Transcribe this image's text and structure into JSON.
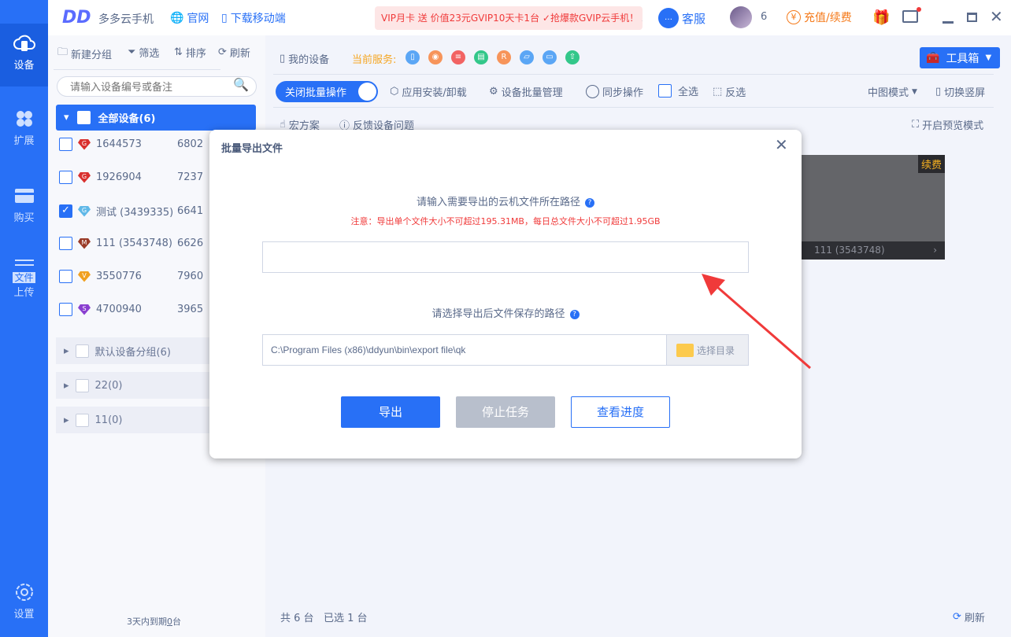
{
  "app": {
    "name": "多多云手机",
    "website": "官网",
    "download": "下载移动端",
    "promo": "VIP月卡 送 价值23元GVIP10天卡1台 ✓抢爆款GVIP云手机！",
    "service": "客服",
    "user_level": "6",
    "recharge": "充值/续费"
  },
  "nav": [
    {
      "label": "设备"
    },
    {
      "label": "扩展"
    },
    {
      "label": "购买"
    },
    {
      "label": "文件上传",
      "badge": "文件",
      "sub": "上传"
    },
    {
      "label": "设置"
    }
  ],
  "left": {
    "new_group": "新建分组",
    "filter": "筛选",
    "sort": "排序",
    "refresh": "刷新",
    "search_placeholder": "请输入设备编号或备注",
    "all_devices": "全部设备(6)",
    "devices": [
      {
        "name": "1644573",
        "days": "6802",
        "tier": "G",
        "color": "#d9302e",
        "checked": false
      },
      {
        "name": "1926904",
        "days": "7237",
        "tier": "G",
        "color": "#d9302e",
        "checked": false
      },
      {
        "name": "测试 (3439335)",
        "days": "6641",
        "tier": "G",
        "color": "#5fb8e8",
        "checked": true
      },
      {
        "name": "111 (3543748)",
        "days": "6626",
        "tier": "M",
        "color": "#9a3b28",
        "checked": false
      },
      {
        "name": "3550776",
        "days": "7960",
        "tier": "V",
        "color": "#f0a020",
        "checked": false
      },
      {
        "name": "4700940",
        "days": "3965",
        "tier": "S",
        "color": "#8a3fd0",
        "checked": false
      }
    ],
    "groups": [
      "默认设备分组(6)",
      "22(0)",
      "11(0)"
    ],
    "expiring": "3天内到期",
    "expiring_count": "0",
    "expiring_unit": "台"
  },
  "main": {
    "my_devices": "我的设备",
    "current_service": "当前服务:",
    "toolbox": "工具箱",
    "batch_toggle": "关闭批量操作",
    "app_install": "应用安装/卸载",
    "batch_manage": "设备批量管理",
    "sync": "同步操作",
    "select_all": "全选",
    "invert": "反选",
    "view_mode": "中图模式",
    "switch_portrait": "切换竖屏",
    "macro": "宏方案",
    "feedback": "反馈设备问题",
    "preview": "开启预览模式",
    "renew": "续费",
    "card_name": "111 (3543748)",
    "total": "共 6 台",
    "selected": "已选 1 台",
    "refresh": "刷新"
  },
  "dialog": {
    "title": "批量导出文件",
    "source_label": "请输入需要导出的云机文件所在路径",
    "warning": "注意：导出单个文件大小不可超过195.31MB，每日总文件大小不可超过1.95GB",
    "source_value": "",
    "dest_label": "请选择导出后文件保存的路径",
    "dest_value": "C:\\Program Files (x86)\\ddyun\\bin\\export file\\qk",
    "choose_dir": "选择目录",
    "export": "导出",
    "stop": "停止任务",
    "progress": "查看进度"
  }
}
